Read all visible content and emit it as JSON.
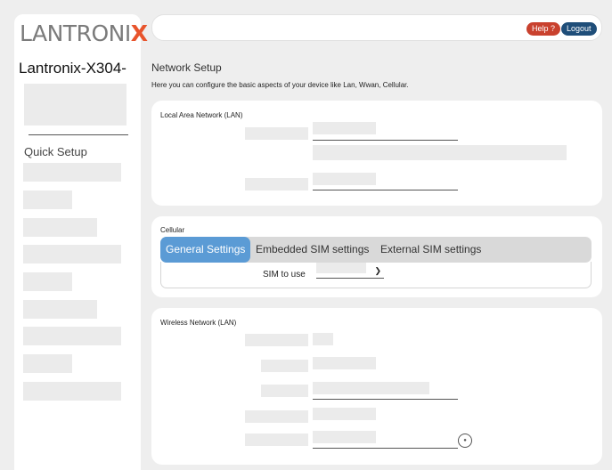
{
  "sidebar": {
    "logo_main": "LANTRONI",
    "logo_x": "X",
    "device_name": "Lantronix-X304-",
    "quick_setup": "Quick Setup"
  },
  "header": {
    "help_label": "Help ?",
    "logout_label": "Logout"
  },
  "page": {
    "title": "Network Setup",
    "description": "Here you can configure the basic aspects of your device like Lan, Wwan, Cellular."
  },
  "lan": {
    "title": "Local Area Network (LAN)"
  },
  "cellular": {
    "title": "Cellular",
    "tabs": [
      {
        "label": "General Settings",
        "active": true
      },
      {
        "label": "Embedded SIM settings",
        "active": false
      },
      {
        "label": "External SIM settings",
        "active": false
      }
    ],
    "sim_label": "SIM to use"
  },
  "wireless": {
    "title": "Wireless Network (LAN)"
  },
  "colors": {
    "accent": "#5b9bd5",
    "help": "#c9412e",
    "logout": "#1f4e79",
    "logo_x": "#e8542c"
  }
}
